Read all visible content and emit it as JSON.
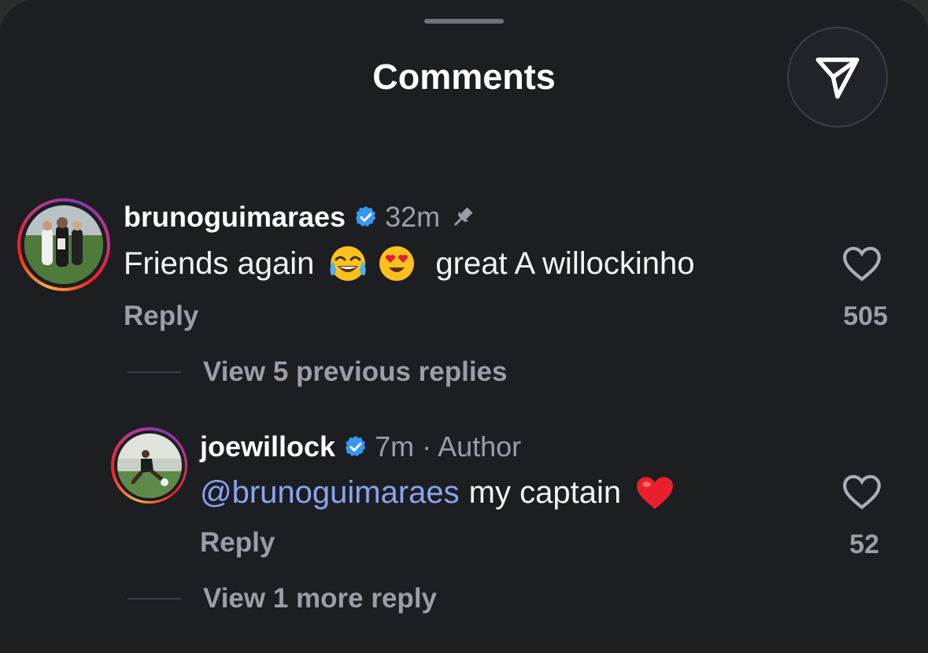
{
  "header": {
    "title": "Comments",
    "share_icon": "paper-plane-icon"
  },
  "comments": [
    {
      "username": "brunoguimaraes",
      "verified": true,
      "time": "32m",
      "pinned": true,
      "text_parts": [
        "Friends again",
        "great A willockinho"
      ],
      "emojis": [
        "face-with-tears-of-joy-emoji",
        "heart-eyes-emoji"
      ],
      "reply_label": "Reply",
      "likes": "505",
      "view_replies": "View 5 previous replies"
    },
    {
      "username": "joewillock",
      "verified": true,
      "time": "7m · Author",
      "mention": "@brunoguimaraes",
      "text": "my captain",
      "emojis": [
        "red-heart-emoji"
      ],
      "reply_label": "Reply",
      "likes": "52",
      "view_replies": "View 1 more reply"
    }
  ],
  "colors": {
    "background": "#1c1e22",
    "text": "#f2f3f5",
    "muted": "#9a9ea6",
    "mention": "#8aa4f0",
    "verified": "#3897f0"
  }
}
